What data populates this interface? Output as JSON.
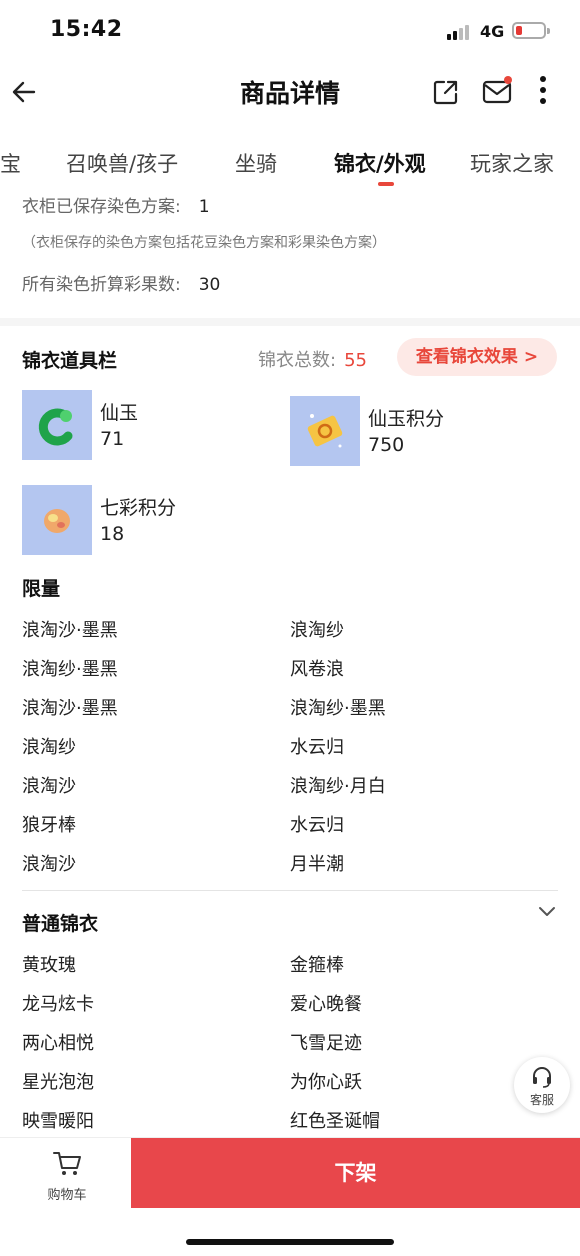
{
  "status_bar": {
    "time": "15:42",
    "network": "4G"
  },
  "nav": {
    "title": "商品详情"
  },
  "tabs": [
    "宝",
    "召唤兽/孩子",
    "坐骑",
    "锦衣/外观",
    "玩家之家"
  ],
  "active_tab": "锦衣/外观",
  "dye_info": {
    "saved_schemes_label": "衣柜已保存染色方案:",
    "saved_schemes_value": "1",
    "note": "（衣柜保存的染色方案包括花豆染色方案和彩果染色方案）",
    "fruit_count_label": "所有染色折算彩果数:",
    "fruit_count_value": "30"
  },
  "props": {
    "title": "锦衣道具栏",
    "total_label": "锦衣总数:",
    "total_value": "55",
    "view_button": "查看锦衣效果 >",
    "items": [
      {
        "name": "仙玉",
        "qty": "71"
      },
      {
        "name": "仙玉积分",
        "qty": "750"
      },
      {
        "name": "七彩积分",
        "qty": "18"
      }
    ]
  },
  "limited": {
    "title": "限量",
    "items": [
      "浪淘沙·墨黑",
      "浪淘纱",
      "浪淘纱·墨黑",
      "风卷浪",
      "浪淘沙·墨黑",
      "浪淘纱·墨黑",
      "浪淘纱",
      "水云归",
      "浪淘沙",
      "浪淘纱·月白",
      "狼牙棒",
      "水云归",
      "浪淘沙",
      "月半潮"
    ]
  },
  "normal": {
    "title": "普通锦衣",
    "items": [
      "黄玫瑰",
      "金箍棒",
      "龙马炫卡",
      "爱心晚餐",
      "两心相悦",
      "飞雪足迹",
      "星光泡泡",
      "为你心跃",
      "映雪暖阳",
      "红色圣诞帽"
    ]
  },
  "service": {
    "label": "客服"
  },
  "bottom": {
    "cart_label": "购物车",
    "delist_button": "下架"
  },
  "colors": {
    "accent": "#e8473b",
    "thumb_bg": "#b4c6f0",
    "button_bg": "#fde9e6"
  }
}
